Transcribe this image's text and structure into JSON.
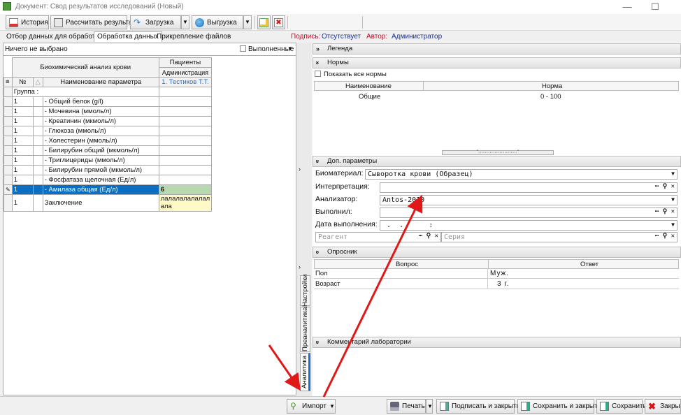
{
  "window": {
    "title": "Документ: Свод результатов исследований (Новый)"
  },
  "toolbar": {
    "history": "История",
    "calc": "Рассчитать результат",
    "load": "Загрузка",
    "unload": "Выгрузка",
    "sign_label": "Подпись:",
    "sign_value": "Отсутствует",
    "author_label": "Автор:",
    "author_value": "Администратор"
  },
  "tabs": [
    "Отбор данных для обработки",
    "Обработка данных",
    "Прикрепление файлов"
  ],
  "left": {
    "filter_text": "Ничего не выбрано",
    "completed_label": "Выполненные",
    "header_group": "Биохимический анализ крови",
    "header_patients": "Пациенты",
    "header_admin": "Администрация",
    "col_no": "№",
    "col_name": "Наименование параметра",
    "col_patient": "1. Тестиков Т.Т.",
    "group_label": "Группа :",
    "rows": [
      {
        "no": "1",
        "name": "- Общий белок (g/l)",
        "val": ""
      },
      {
        "no": "1",
        "name": "- Мочевина (ммоль/л)",
        "val": ""
      },
      {
        "no": "1",
        "name": " - Креатинин (мкмоль/л)",
        "val": ""
      },
      {
        "no": "1",
        "name": "- Глюкоза (ммоль/л)",
        "val": ""
      },
      {
        "no": "1",
        "name": "- Холестерин (ммоль/л)",
        "val": ""
      },
      {
        "no": "1",
        "name": "- Билирубин общий (мкмоль/л)",
        "val": ""
      },
      {
        "no": "1",
        "name": " - Триглицериды (ммоль/л)",
        "val": ""
      },
      {
        "no": "1",
        "name": "- Билирубин прямой (мкмоль/л)",
        "val": ""
      },
      {
        "no": "1",
        "name": " - Фосфатаза щелочная (Ед/л)",
        "val": ""
      },
      {
        "no": "1",
        "name": "- Амилаза общая (Ед/л)",
        "val": "6"
      }
    ],
    "conclusion_no": "1",
    "conclusion_name": "Заключение",
    "conclusion_val_1": "лалалалалалал",
    "conclusion_val_2": "ала"
  },
  "side_tabs": [
    "Настройки",
    "Преаналитика",
    "Аналитика"
  ],
  "right": {
    "legend": "Легенда",
    "norms": "Нормы",
    "show_all": "Показать все нормы",
    "norm_col_name": "Наименование",
    "norm_col_norm": "Норма",
    "norm_row_name": "Общие",
    "norm_row_value": "0 - 100",
    "extra": "Доп. параметры",
    "biomaterial_label": "Биоматериал:",
    "biomaterial_value": "Сыворотка крови (Образец)",
    "interp_label": "Интерпретация:",
    "analyzer_label": "Анализатор:",
    "analyzer_value": "Antos-2010",
    "performed_label": "Выполнил:",
    "date_label": "Дата выполнения:",
    "date_value": " .  .      :  ",
    "reagent_placeholder": "Реагент",
    "series_placeholder": "Серия",
    "survey": "Опросник",
    "q_col": "Вопрос",
    "a_col": "Ответ",
    "q1": "Пол",
    "a1": "Муж.",
    "q2": "Возраст",
    "a2": "3 г.",
    "comment": "Комментарий лаборатории"
  },
  "bottom": {
    "import": "Импорт",
    "print": "Печать",
    "sign_close": "Подписать и закрыть",
    "save_close": "Сохранить и закрыть",
    "save": "Сохранить",
    "close": "Закрыть"
  }
}
